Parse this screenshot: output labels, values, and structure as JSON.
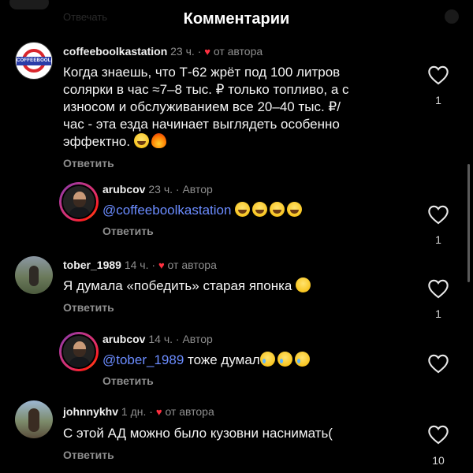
{
  "header": {
    "title": "Комментарии",
    "ghost_text": "Отвечать"
  },
  "comments": [
    {
      "username": "coffeeboolkastation",
      "time": "23 ч.",
      "author_note": "от автора",
      "avatar_text": "COFFEEBOOLKA",
      "text_lines": [
        "Когда знаешь, что Т-62 жрёт под 100 литров",
        "солярки в час ≈7–8 тыс. ₽ только топливо, а с",
        "износом и обслуживанием все 20–40 тыс. ₽/",
        "час - эта езда начинает выглядеть особенно",
        "эффектно."
      ],
      "emojis": [
        "grinning-emoji",
        "fire-emoji"
      ],
      "reply_label": "Ответить",
      "like_count": "1"
    },
    {
      "username": "arubcov",
      "time": "23 ч.",
      "author_tag": "Автор",
      "mention": "@coffeeboolkastation",
      "emojis": [
        "laughing-emoji",
        "laughing-emoji",
        "laughing-emoji",
        "laughing-emoji"
      ],
      "reply_label": "Ответить",
      "like_count": "1"
    },
    {
      "username": "tober_1989",
      "time": "14 ч.",
      "author_note": "от автора",
      "text": "Я думала «победить» старая японка",
      "emojis": [
        "upside-down-emoji"
      ],
      "reply_label": "Ответить",
      "like_count": "1"
    },
    {
      "username": "arubcov",
      "time": "14 ч.",
      "author_tag": "Автор",
      "mention": "@tober_1989",
      "text": " тоже думал",
      "emojis": [
        "crying-emoji",
        "crying-emoji",
        "crying-emoji"
      ],
      "reply_label": "Ответить",
      "like_count": ""
    },
    {
      "username": "johnnykhv",
      "time": "1 дн.",
      "author_note": "от автора",
      "text": "С этой АД можно было кузовни наснимать(",
      "reply_label": "Ответить",
      "like_count": "10"
    }
  ],
  "colors": {
    "background": "#000000",
    "mention": "#6b8cff",
    "heart_red": "#ff3040",
    "muted": "#8e8e8e"
  }
}
